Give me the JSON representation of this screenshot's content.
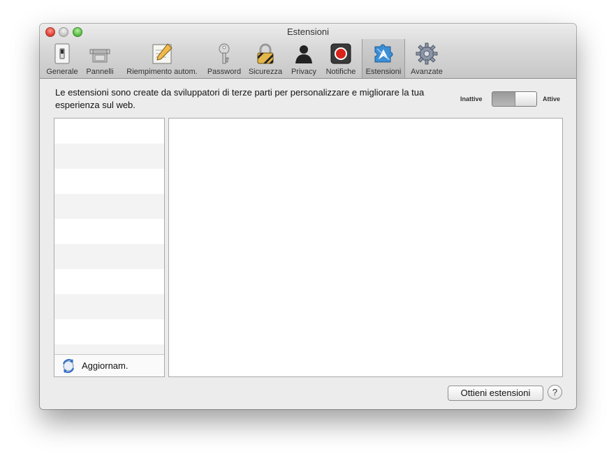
{
  "window": {
    "title": "Estensioni"
  },
  "toolbar": {
    "items": [
      {
        "label": "Generale",
        "icon": "switch-icon"
      },
      {
        "label": "Pannelli",
        "icon": "tabs-icon"
      },
      {
        "label": "Riempimento autom.",
        "icon": "pencil-form-icon"
      },
      {
        "label": "Password",
        "icon": "key-icon"
      },
      {
        "label": "Sicurezza",
        "icon": "padlock-icon"
      },
      {
        "label": "Privacy",
        "icon": "person-silhouette-icon"
      },
      {
        "label": "Notifiche",
        "icon": "red-record-icon"
      },
      {
        "label": "Estensioni",
        "icon": "puzzle-compass-icon",
        "selected": true
      },
      {
        "label": "Avanzate",
        "icon": "gear-icon"
      }
    ]
  },
  "extensions": {
    "description": "Le estensioni sono create da sviluppatori di terze parti per personalizzare e migliorare la tua esperienza sul web.",
    "toggle": {
      "off_label": "Inattive",
      "on_label": "Attive",
      "state": "on"
    },
    "updates_label": "Aggiornam.",
    "get_extensions_button": "Ottieni estensioni",
    "help_button": "?"
  }
}
